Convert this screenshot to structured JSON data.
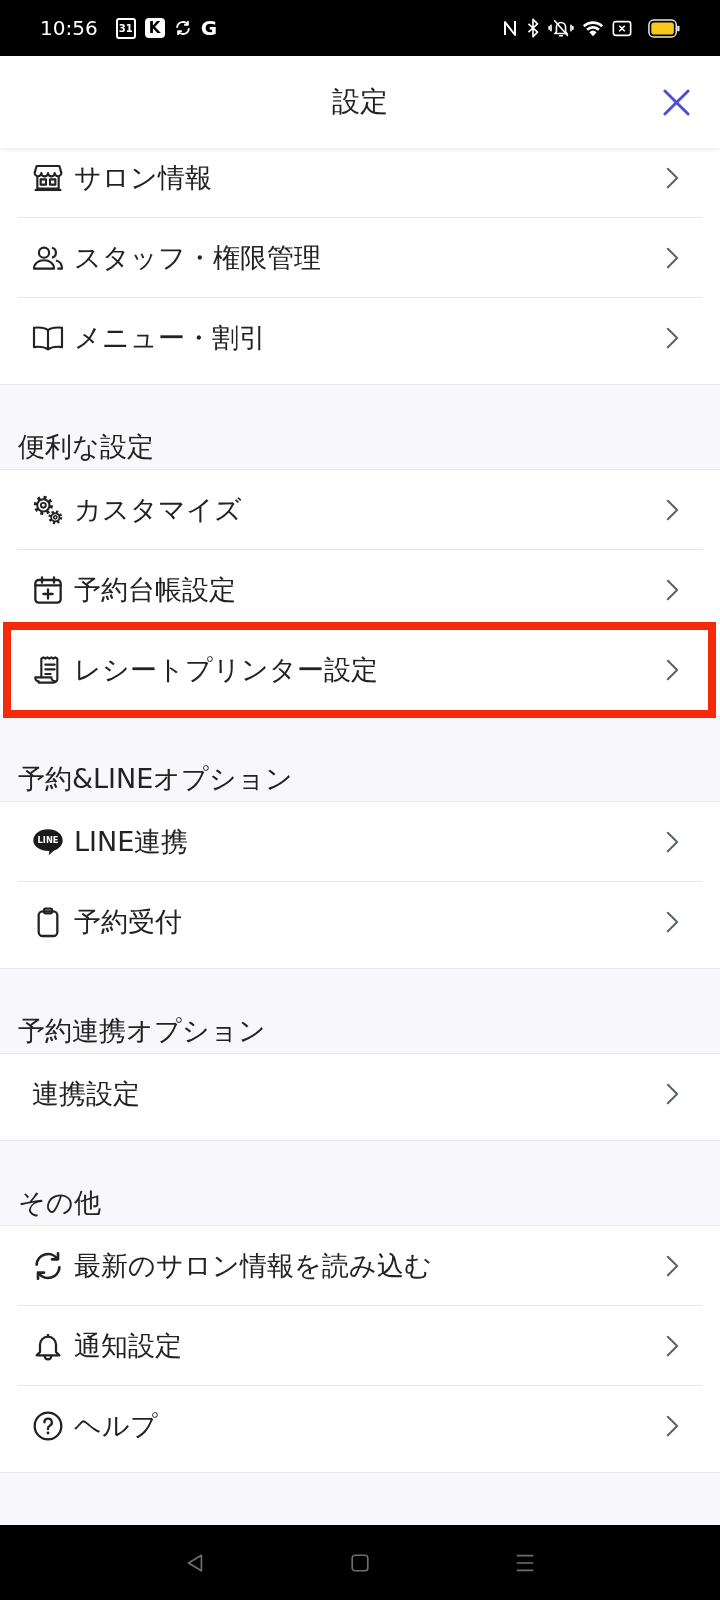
{
  "status_bar": {
    "time": "10:56",
    "notifications": [
      {
        "kind": "calendar",
        "label": "31"
      },
      {
        "kind": "badge",
        "label": "K"
      },
      {
        "kind": "sync"
      },
      {
        "kind": "letter",
        "label": "G"
      }
    ]
  },
  "header": {
    "title": "設定"
  },
  "sections": [
    {
      "items": [
        {
          "label": "サロン情報",
          "kind": "store",
          "highlighted": false
        },
        {
          "label": "スタッフ・権限管理",
          "kind": "people",
          "highlighted": false
        },
        {
          "label": "メニュー・割引",
          "kind": "book",
          "highlighted": false
        }
      ]
    },
    {
      "title": "便利な設定",
      "items": [
        {
          "label": "カスタマイズ",
          "kind": "gears",
          "highlighted": false
        },
        {
          "label": "予約台帳設定",
          "kind": "calendar",
          "highlighted": false
        },
        {
          "label": "レシートプリンター設定",
          "kind": "receipt",
          "highlighted": true
        }
      ]
    },
    {
      "title": "予約&LINEオプション",
      "items": [
        {
          "label": "LINE連携",
          "kind": "bubble",
          "icon_label": "LINE",
          "highlighted": false
        },
        {
          "label": "予約受付",
          "kind": "clipboard",
          "highlighted": false
        }
      ]
    },
    {
      "title": "予約連携オプション",
      "items": [
        {
          "label": "連携設定",
          "kind": "plain",
          "highlighted": false
        }
      ]
    },
    {
      "title": "その他",
      "items": [
        {
          "label": "最新のサロン情報を読み込む",
          "kind": "sync",
          "highlighted": false
        },
        {
          "label": "通知設定",
          "kind": "bell",
          "highlighted": false
        },
        {
          "label": "ヘルプ",
          "kind": "help",
          "highlighted": false
        }
      ]
    }
  ]
}
